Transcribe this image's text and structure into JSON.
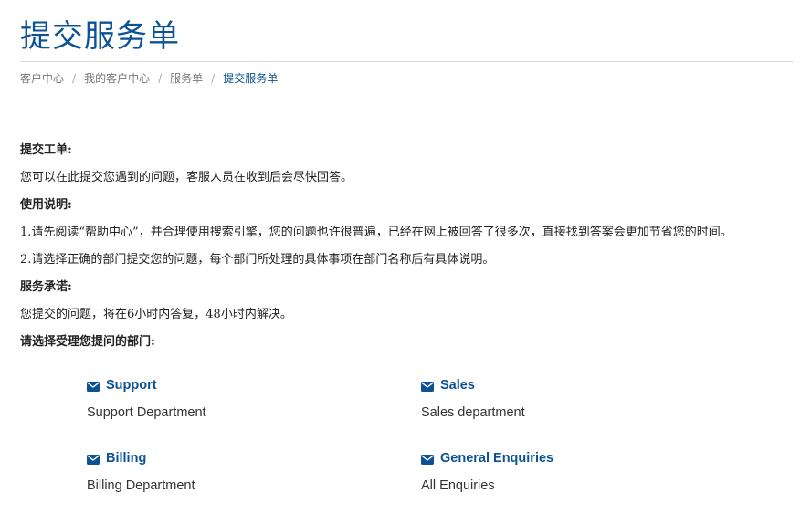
{
  "page": {
    "title": "提交服务单"
  },
  "breadcrumb": {
    "items": [
      "客户中心",
      "我的客户中心",
      "服务单"
    ],
    "separator": "/",
    "current": "提交服务单"
  },
  "content": {
    "section1_heading": "提交工单:",
    "section1_text": "您可以在此提交您遇到的问题，客服人员在收到后会尽快回答。",
    "section2_heading": "使用说明:",
    "section2_item1": "1.请先阅读“帮助中心”，并合理使用搜索引擎，您的问题也许很普遍，已经在网上被回答了很多次，直接找到答案会更加节省您的时间。",
    "section2_item2": "2.请选择正确的部门提交您的问题，每个部门所处理的具体事项在部门名称后有具体说明。",
    "section3_heading": "服务承诺:",
    "section3_text": "您提交的问题，将在6小时内答复，48小时内解决。",
    "select_prompt": "请选择受理您提问的部门:"
  },
  "departments": [
    {
      "name": "Support",
      "description": "Support Department",
      "icon": "envelope-icon"
    },
    {
      "name": "Sales",
      "description": "Sales department",
      "icon": "envelope-icon"
    },
    {
      "name": "Billing",
      "description": "Billing Department",
      "icon": "envelope-icon"
    },
    {
      "name": "General Enquiries",
      "description": "All Enquiries",
      "icon": "envelope-icon"
    }
  ],
  "colors": {
    "accent": "#0b5394",
    "text": "#222222",
    "muted": "#777777",
    "rule": "#d8d8d8"
  }
}
